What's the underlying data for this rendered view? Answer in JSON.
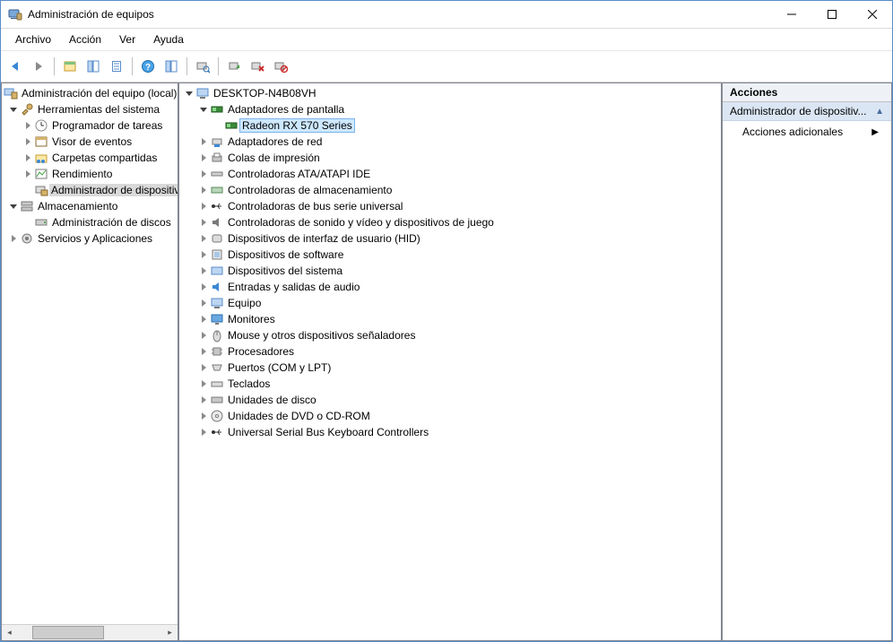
{
  "window": {
    "title": "Administración de equipos"
  },
  "menu": {
    "file": "Archivo",
    "action": "Acción",
    "view": "Ver",
    "help": "Ayuda"
  },
  "left_tree": {
    "root": "Administración del equipo (local)",
    "system_tools": "Herramientas del sistema",
    "task_scheduler": "Programador de tareas",
    "event_viewer": "Visor de eventos",
    "shared_folders": "Carpetas compartidas",
    "performance": "Rendimiento",
    "device_manager": "Administrador de dispositivos",
    "storage": "Almacenamiento",
    "disk_mgmt": "Administración de discos",
    "services_apps": "Servicios y Aplicaciones"
  },
  "center_tree": {
    "computer": "DESKTOP-N4B08VH",
    "display_adapters": "Adaptadores de pantalla",
    "radeon": "Radeon RX 570 Series",
    "network_adapters": "Adaptadores de red",
    "print_queues": "Colas de impresión",
    "ata_atapi": "Controladoras ATA/ATAPI IDE",
    "storage_controllers": "Controladoras de almacenamiento",
    "usb_controllers": "Controladoras de bus serie universal",
    "sound_video_game": "Controladoras de sonido y vídeo y dispositivos de juego",
    "hid": "Dispositivos de interfaz de usuario (HID)",
    "software_devices": "Dispositivos de software",
    "system_devices": "Dispositivos del sistema",
    "audio_io": "Entradas y salidas de audio",
    "computer_cat": "Equipo",
    "monitors": "Monitores",
    "mice": "Mouse y otros dispositivos señaladores",
    "processors": "Procesadores",
    "ports": "Puertos (COM y LPT)",
    "keyboards": "Teclados",
    "disk_drives": "Unidades de disco",
    "dvd_cd": "Unidades de DVD o CD-ROM",
    "usb_keyboard": "Universal Serial Bus Keyboard Controllers"
  },
  "actions": {
    "header": "Acciones",
    "group_title": "Administrador de dispositiv...",
    "more_actions": "Acciones adicionales"
  }
}
